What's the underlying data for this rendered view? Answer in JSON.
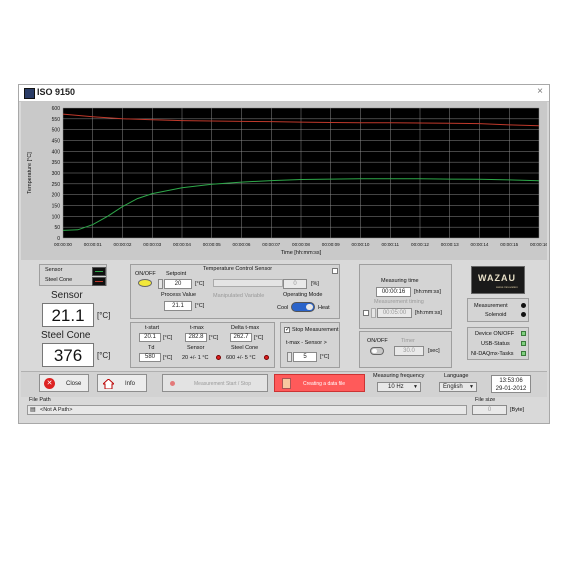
{
  "window": {
    "title": "ISO 9150",
    "close_glyph": "×"
  },
  "chart_data": {
    "type": "line",
    "title": "",
    "xlabel": "Time [hh:mm:ss]",
    "ylabel": "Temperature [°C]",
    "ylim": [
      0,
      600
    ],
    "yticks": [
      0,
      50,
      100,
      150,
      200,
      250,
      300,
      350,
      400,
      450,
      500,
      550,
      600
    ],
    "xticks": [
      "00:00:00",
      "00:00:01",
      "00:00:02",
      "00:00:03",
      "00:00:04",
      "00:00:05",
      "00:00:06",
      "00:00:07",
      "00:00:08",
      "00:00:09",
      "00:00:10",
      "00:00:11",
      "00:00:12",
      "00:00:13",
      "00:00:14",
      "00:00:15",
      "00:00:16"
    ],
    "grid": true,
    "background": "#000000",
    "series": [
      {
        "color": "#c0392b",
        "x": [
          0,
          1,
          2,
          3,
          4,
          5,
          6,
          7,
          8,
          9,
          10,
          11,
          12,
          13,
          14,
          15,
          16
        ],
        "values": [
          572,
          560,
          550,
          546,
          542,
          540,
          538,
          537,
          535,
          533,
          532,
          532,
          531,
          530,
          528,
          522,
          518
        ]
      },
      {
        "color": "#2ea84a",
        "x": [
          0,
          0.5,
          1,
          1.5,
          2,
          2.5,
          3,
          4,
          5,
          6,
          7,
          8,
          9,
          10,
          11,
          12,
          13,
          14,
          15,
          16
        ],
        "values": [
          35,
          38,
          62,
          100,
          145,
          182,
          205,
          232,
          248,
          258,
          265,
          270,
          272,
          273,
          273,
          273,
          272,
          271,
          268,
          264
        ]
      }
    ]
  },
  "legend": {
    "sensor": "Sensor",
    "steel_cone": "Steel Cone"
  },
  "readouts": {
    "sensor_label": "Sensor",
    "sensor_value": "21.1",
    "sensor_unit": "[°C]",
    "cone_label": "Steel Cone",
    "cone_value": "376",
    "cone_unit": "[°C]"
  },
  "control": {
    "title": "Temperature Control Sensor",
    "onoff_label": "ON/OFF",
    "setpoint_label": "Setpoint",
    "setpoint_value": "20",
    "setpoint_unit": "[°C]",
    "manip_value": "0",
    "manip_unit": "[%]",
    "manip_label": "Manipulated Variable",
    "process_label": "Process Value",
    "process_value": "21.1",
    "process_unit": "[°C]",
    "mode_label": "Operating Mode",
    "mode_left": "Cool",
    "mode_right": "Heat"
  },
  "stats": {
    "tstart_label": "t-start",
    "tstart_value": "20.1",
    "tstart_unit": "[°C]",
    "tmax_label": "t-max",
    "tmax_value": "282.8",
    "tmax_unit": "[°C]",
    "delta_label": "Delta t-max",
    "delta_value": "262.7",
    "delta_unit": "[°C]",
    "td_label": "Td",
    "td_value": "580",
    "td_unit": "[°C]",
    "sensor_label": "Sensor",
    "sensor_spec": "20 +/- 1 °C",
    "cone_label": "Steel Cone",
    "cone_spec": "600 +/- 5 °C"
  },
  "stop": {
    "check_label": "Stop Measurement",
    "tmax_label": "t-max - Sensor >",
    "tmax_value": "5",
    "tmax_unit": "[°C]"
  },
  "measure": {
    "time_label": "Measuring time",
    "time_value": "00:00:16",
    "time_unit": "[hh:mm:ss]",
    "timing_label": "Measurement timing",
    "timing_value": "00:05:00",
    "timing_unit": "[hh:mm:ss]"
  },
  "timer": {
    "onoff_label": "ON/OFF",
    "label": "Timer",
    "value": "30.0",
    "unit": "[sec]"
  },
  "logo": {
    "text": "WAZAU",
    "sub": "swiss innovation"
  },
  "status": {
    "measurement": "Measurement",
    "solenoid": "Solenoid",
    "device": "Device ON/OFF",
    "usb": "USB-Status",
    "nidaq": "NI-DAQmx-Tasks"
  },
  "buttons": {
    "close": "Close",
    "info": "Info",
    "measure": "Measurement Start / Stop",
    "create_file": "Creating a data file"
  },
  "freq": {
    "label": "Measuring frequency",
    "value": "10 Hz"
  },
  "language": {
    "label": "Language",
    "value": "English"
  },
  "clock": {
    "time": "13:53:06",
    "date": "29-01-2012"
  },
  "file": {
    "path_label": "File Path",
    "path_value": "<Not A Path>",
    "size_label": "File size",
    "size_value": "0",
    "size_unit": "[Byte]"
  },
  "colors": {
    "window_bg": "#d9d9d9",
    "plot_bg": "#000000",
    "sensor_line": "#2ea84a",
    "cone_line": "#c0392b",
    "create_button": "#ff5a5a",
    "led_on": "#e02020"
  }
}
